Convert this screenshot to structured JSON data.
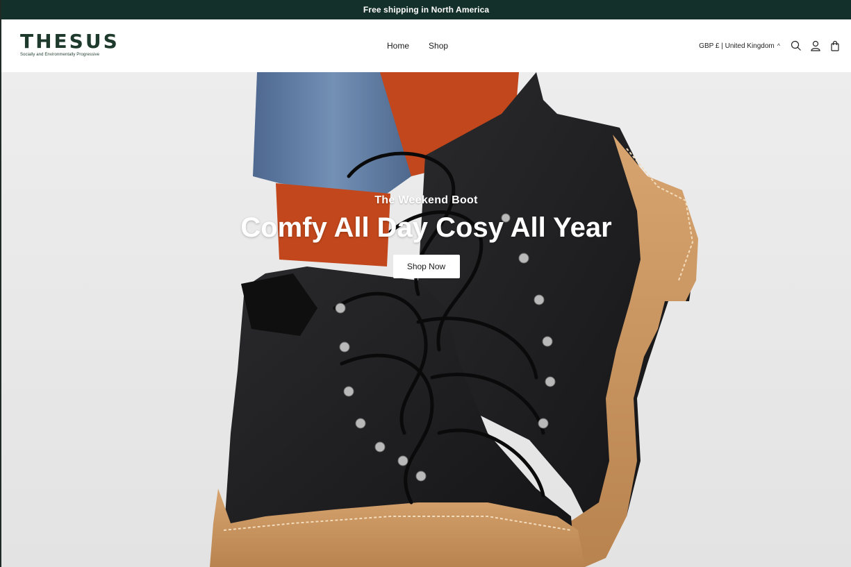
{
  "announcement": {
    "text": "Free shipping in North America"
  },
  "brand": {
    "name": "THESUS",
    "tagline": "Socially and Environmentally Progressive",
    "color": "#1d3a2c"
  },
  "nav": {
    "items": [
      {
        "label": "Home"
      },
      {
        "label": "Shop"
      }
    ]
  },
  "header_right": {
    "locale": "GBP £ | United Kingdom",
    "caret_icon": "chevron-up-icon",
    "icons": [
      "search-icon",
      "account-icon",
      "cart-icon"
    ]
  },
  "hero": {
    "subtitle": "The Weekend Boot",
    "title": "Comfy All Day Cosy All Year",
    "cta_label": "Shop Now",
    "image": "black-hiking-boots-gum-sole-orange-socks"
  },
  "colors": {
    "announcement_bg": "#14302a",
    "boot_black": "#1b1b1d",
    "sole_tan": "#c99561",
    "sock_orange": "#c2471c",
    "denim_blue": "#5a7399"
  }
}
